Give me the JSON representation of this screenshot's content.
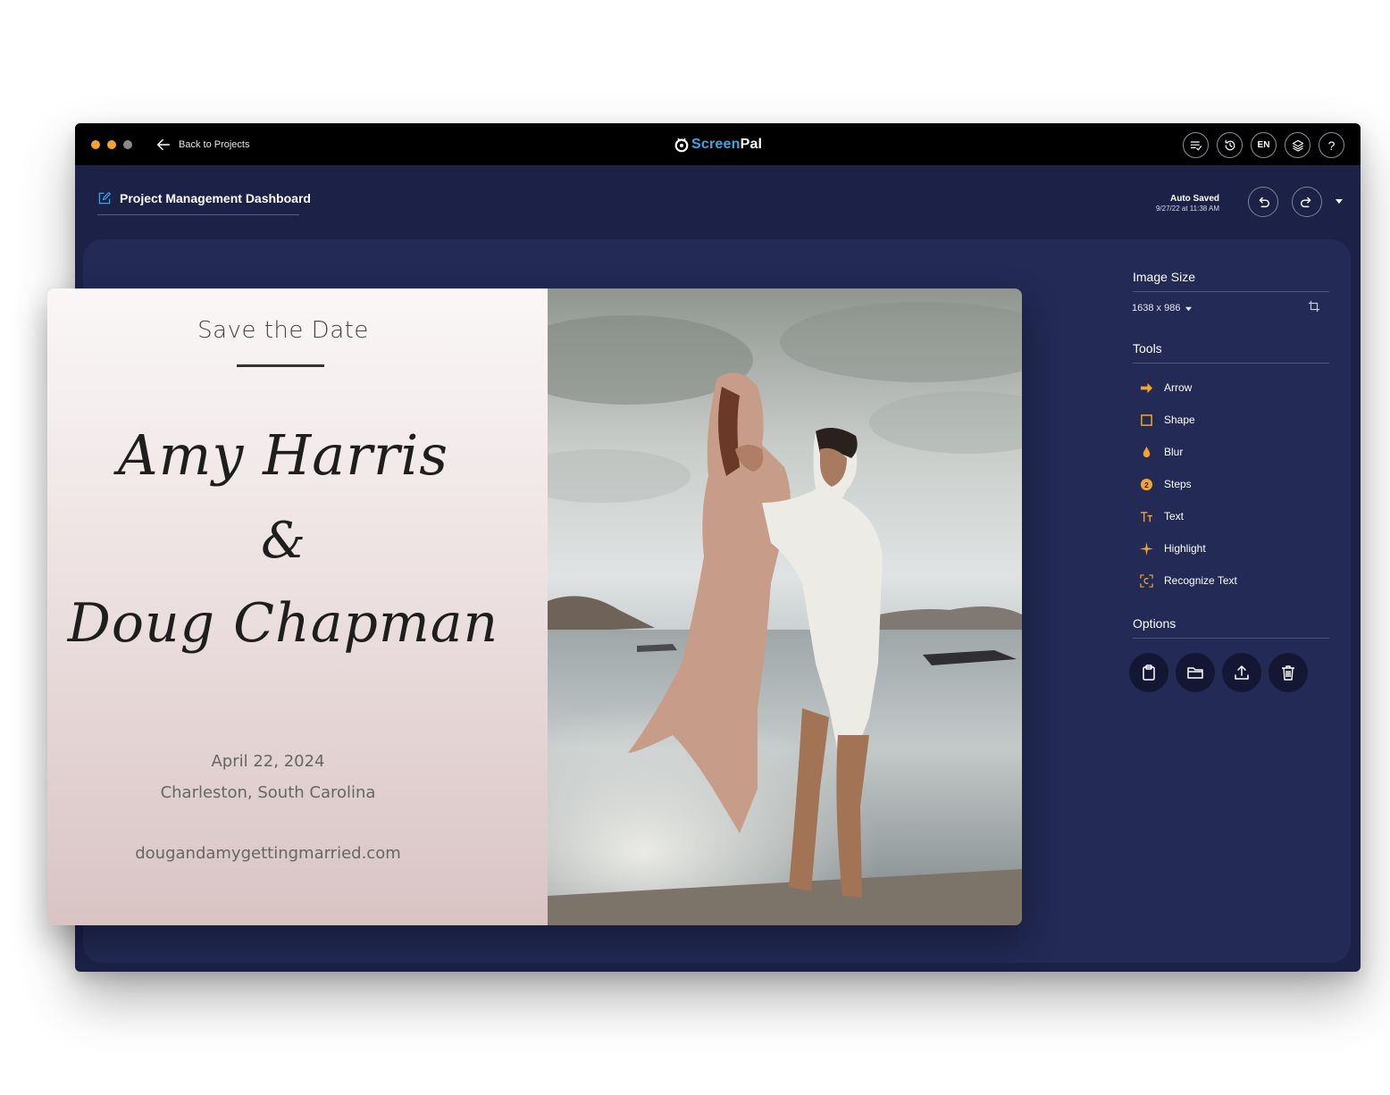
{
  "app": {
    "logo_prefix": "Screen",
    "logo_suffix": "Pal",
    "back_label": "Back to Projects",
    "top_icons": [
      {
        "name": "checklist-icon",
        "label": ""
      },
      {
        "name": "history-icon",
        "label": ""
      },
      {
        "name": "language-button",
        "label": "EN"
      },
      {
        "name": "layers-icon",
        "label": ""
      },
      {
        "name": "help-icon",
        "label": "?"
      }
    ],
    "colors": {
      "titlebar": "#000000",
      "window_bg": "#1c2148",
      "workspace_bg": "#222a55",
      "accent_orange": "#f4a32c",
      "logo_blue": "#3aa6e6",
      "traffic": [
        "#f4a32c",
        "#f4a32c",
        "#8a8a8a"
      ]
    }
  },
  "header": {
    "project_title": "Project Management Dashboard",
    "autosave_label": "Auto Saved",
    "autosave_time": "9/27/22 at 11:38 AM"
  },
  "panel": {
    "image_size_title": "Image Size",
    "image_size_value": "1638 x 986",
    "tools_title": "Tools",
    "tools": [
      {
        "label": "Arrow",
        "icon": "arrow-icon"
      },
      {
        "label": "Shape",
        "icon": "shape-icon"
      },
      {
        "label": "Blur",
        "icon": "blur-icon"
      },
      {
        "label": "Steps",
        "icon": "steps-icon"
      },
      {
        "label": "Text",
        "icon": "text-icon"
      },
      {
        "label": "Highlight",
        "icon": "highlight-icon"
      },
      {
        "label": "Recognize Text",
        "icon": "recognize-text-icon"
      }
    ],
    "options_title": "Options",
    "options": [
      "clipboard-icon",
      "folder-icon",
      "upload-icon",
      "trash-icon"
    ]
  },
  "card": {
    "heading": "Save the Date",
    "name1": "Amy Harris",
    "amp": "&",
    "name2": "Doug Chapman",
    "date": "April 22, 2024",
    "location": "Charleston, South Carolina",
    "website": "dougandamygettingmarried.com"
  }
}
